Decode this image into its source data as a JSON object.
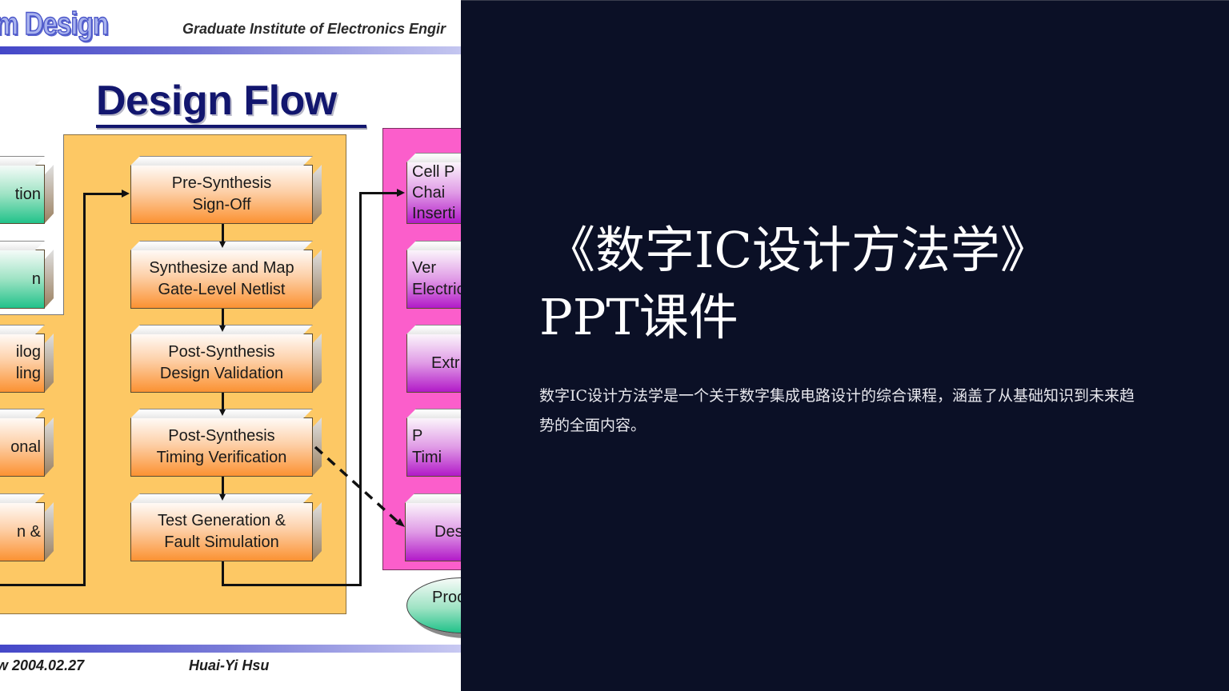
{
  "slide_image": {
    "header": {
      "logo_text": "m Design",
      "institute": "Graduate Institute of Electronics Engir"
    },
    "title": "Design Flow",
    "left_column_boxes": [
      {
        "label": "tion",
        "color": "green"
      },
      {
        "label": "n",
        "color": "green"
      },
      {
        "label": "ilog\nling",
        "color": "orange"
      },
      {
        "label": "onal",
        "color": "orange"
      },
      {
        "label": "n &",
        "color": "orange"
      }
    ],
    "center_column_boxes": [
      {
        "label": "Pre-Synthesis\nSign-Off"
      },
      {
        "label": "Synthesize and Map\nGate-Level Netlist"
      },
      {
        "label": "Post-Synthesis\nDesign Validation"
      },
      {
        "label": "Post-Synthesis\nTiming Verification"
      },
      {
        "label": "Test Generation &\nFault Simulation"
      }
    ],
    "right_column_boxes": [
      {
        "label": "Cell P\n Chai\nInserti"
      },
      {
        "label": "  Ver\nElectric"
      },
      {
        "label": "Extr"
      },
      {
        "label": "     P\n Timi"
      },
      {
        "label": "Des"
      }
    ],
    "ellipse_label": "Proc",
    "footer": {
      "date": "w 2004.02.27",
      "author": "Huai-Yi Hsu"
    },
    "colors": {
      "orange_panel": "#fdc864",
      "magenta_panel": "#fb5ecb",
      "title_navy": "#12166e",
      "header_bar": "#4447c8"
    }
  },
  "title_panel": {
    "title_line1": "《数字IC设计方法学》",
    "title_line2": "PPT课件",
    "subtitle": "数字IC设计方法学是一个关于数字集成电路设计的综合课程，涵盖了从基础知识到未来趋势的全面内容。",
    "background_color": "#0b1026"
  }
}
